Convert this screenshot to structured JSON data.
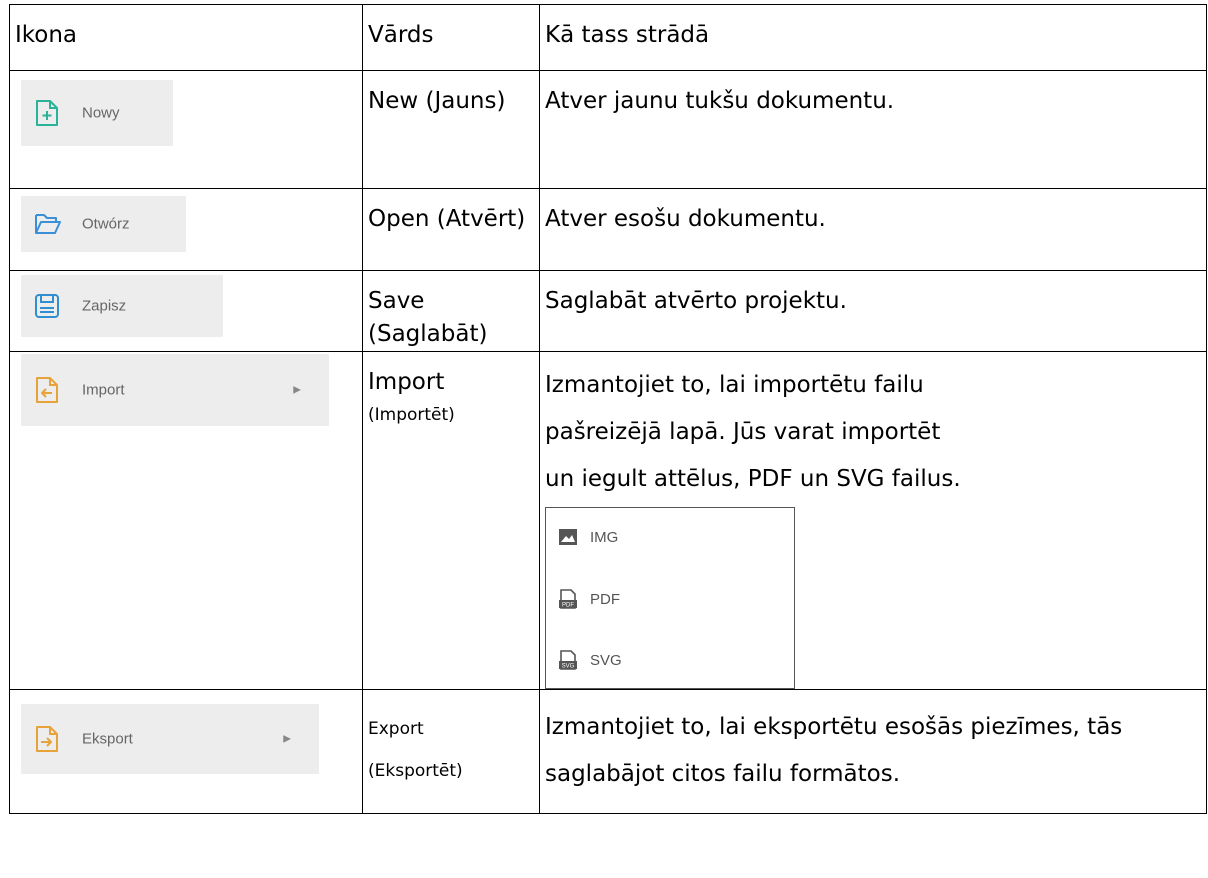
{
  "header": {
    "col_icon": "Ikona",
    "col_name": "Vārds",
    "col_desc": "Kā tass strādā"
  },
  "rows": {
    "new": {
      "icon_label": "Nowy",
      "name": "New (Jauns)",
      "desc": "Atver jaunu tukšu dokumentu."
    },
    "open": {
      "icon_label": "Otwórz",
      "name": "Open (Atvērt)",
      "desc": "Atver esošu dokumentu."
    },
    "save": {
      "icon_label": "Zapisz",
      "name": "Save (Saglabāt)",
      "desc": "Saglabāt atvērto projektu."
    },
    "import": {
      "icon_label": "Import",
      "name": "Import",
      "name_sub": "(Importēt)",
      "desc": "Izmantojiet to, lai importētu failu pašreizējā lapā. Jūs varat importēt un iegult attēlus, PDF un SVG failus.",
      "submenu": [
        {
          "label": "IMG",
          "icon": "image-icon"
        },
        {
          "label": "PDF",
          "icon": "pdf-file-icon"
        },
        {
          "label": "SVG",
          "icon": "svg-file-icon"
        }
      ]
    },
    "export": {
      "icon_label": "Eksport",
      "name": "Export (Eksportēt)",
      "desc": "Izmantojiet to, lai eksportētu esošās piezīmes, tās saglabājot citos failu formātos."
    }
  },
  "colors": {
    "new_icon": "#2bb39a",
    "open_icon": "#3a8fd6",
    "save_icon": "#2f8fd0",
    "import_icon": "#e7a33a",
    "export_icon": "#e7a33a",
    "button_bg": "#ededed"
  }
}
